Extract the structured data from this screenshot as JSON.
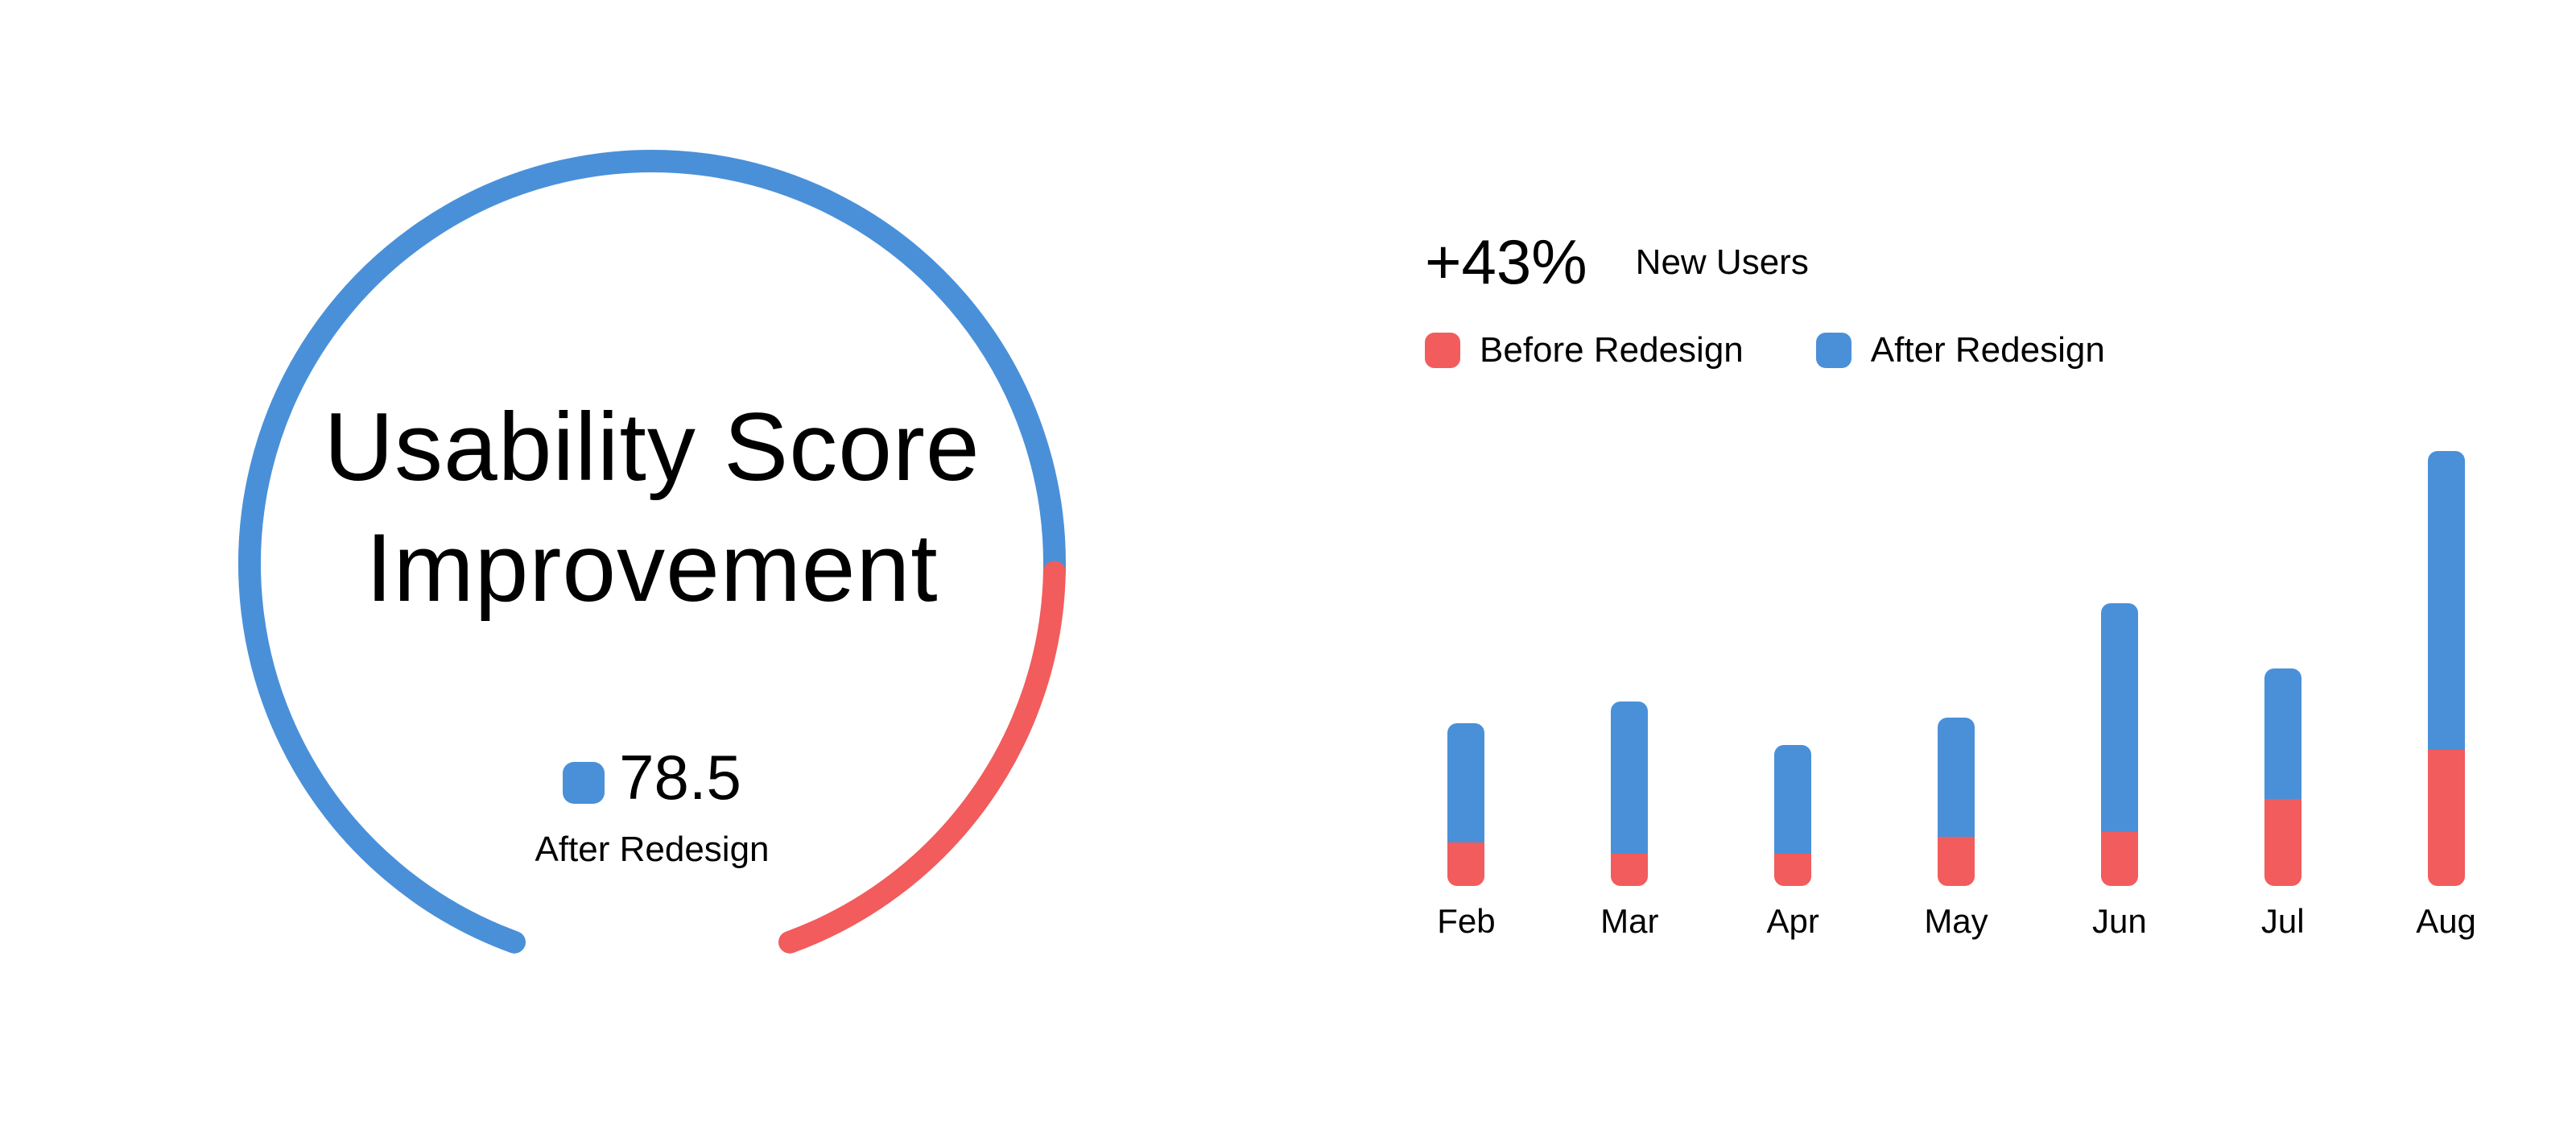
{
  "gauge": {
    "title_line1": "Usability Score",
    "title_line2": "Improvement",
    "value": "78.5",
    "value_label": "After Redesign",
    "value_color": "#4a90d9",
    "arc_primary_color": "#4a90d9",
    "arc_remainder_color": "#f25c5c"
  },
  "bar_header": {
    "metric": "+43%",
    "metric_label": "New Users",
    "legend": [
      {
        "label": "Before Redesign",
        "color": "#f25c5c"
      },
      {
        "label": "After Redesign",
        "color": "#4a90d9"
      }
    ]
  },
  "chart_data": [
    {
      "type": "gauge",
      "title": "Usability Score Improvement",
      "value": 78.5,
      "max": 100,
      "label": "After Redesign",
      "primary_color": "#4a90d9",
      "remainder_color": "#f25c5c"
    },
    {
      "type": "bar",
      "title": "+43% New Users",
      "stacked": true,
      "categories": [
        "Feb",
        "Mar",
        "Apr",
        "May",
        "Jun",
        "Jul",
        "Aug"
      ],
      "series": [
        {
          "name": "Before Redesign",
          "color": "#f25c5c",
          "values": [
            8,
            6,
            6,
            9,
            10,
            16,
            25
          ]
        },
        {
          "name": "After Redesign",
          "color": "#4a90d9",
          "values": [
            22,
            28,
            20,
            22,
            42,
            24,
            55
          ]
        }
      ],
      "ylim": [
        0,
        80
      ],
      "xlabel": "",
      "ylabel": ""
    }
  ]
}
